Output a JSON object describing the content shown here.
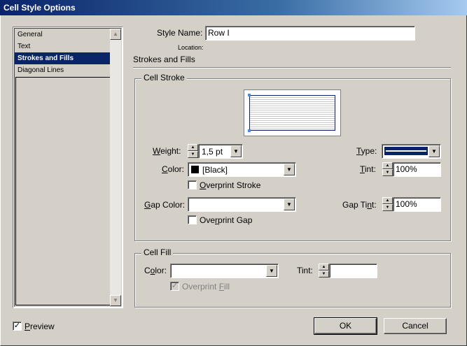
{
  "window": {
    "title": "Cell Style Options"
  },
  "sidebar": {
    "items": [
      {
        "label": "General"
      },
      {
        "label": "Text"
      },
      {
        "label": "Strokes and Fills"
      },
      {
        "label": "Diagonal Lines"
      }
    ]
  },
  "form": {
    "style_name_label": "Style Name:",
    "style_name_value": "Row I",
    "location_label": "Location:",
    "section_title": "Strokes and Fills"
  },
  "cell_stroke": {
    "legend": "Cell Stroke",
    "weight_label": "Weight:",
    "weight_value": "1,5 pt",
    "type_label": "Type:",
    "color_label": "Color:",
    "color_value": "[Black]",
    "tint_label": "Tint:",
    "tint_value": "100%",
    "overprint_stroke_label": "Overprint Stroke",
    "gap_color_label": "Gap Color:",
    "gap_color_value": "",
    "gap_tint_label": "Gap Tint:",
    "gap_tint_value": "100%",
    "overprint_gap_label": "Overprint Gap"
  },
  "cell_fill": {
    "legend": "Cell Fill",
    "color_label": "Color:",
    "color_value": "",
    "tint_label": "Tint:",
    "tint_value": "",
    "overprint_fill_label": "Overprint Fill"
  },
  "footer": {
    "preview_label": "Preview",
    "preview_checked": true,
    "ok_label": "OK",
    "cancel_label": "Cancel"
  },
  "colors": {
    "title_bar": "#0a246a",
    "selection": "#0a246a",
    "stroke_type_line": "#0a246a",
    "dialog_bg": "#d4d0c8"
  }
}
